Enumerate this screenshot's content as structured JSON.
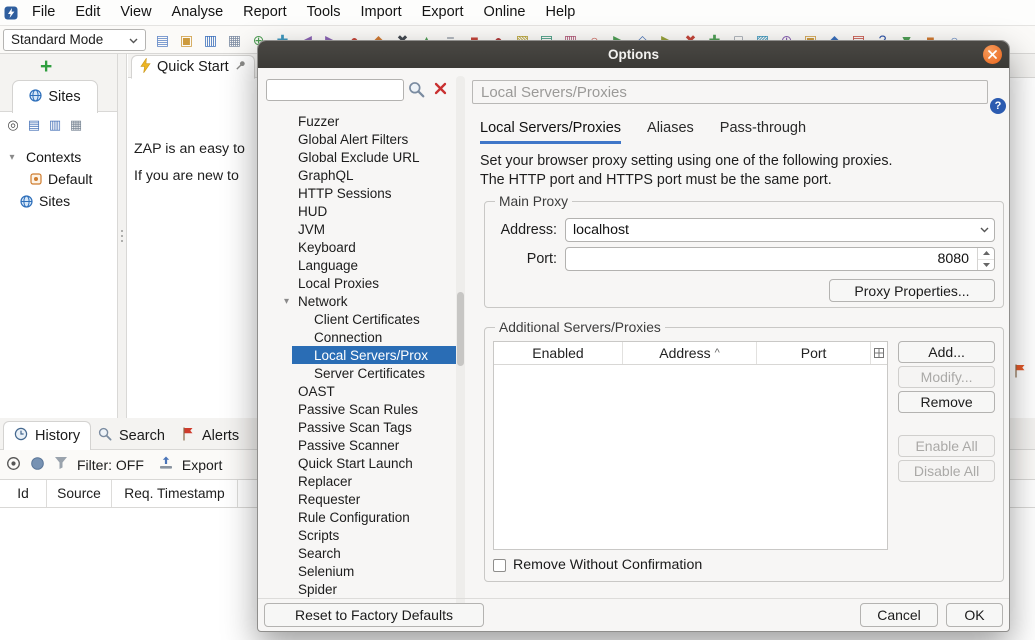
{
  "colors": {
    "selection_blue": "#2a6db5",
    "titlebar_dark": "#3b3a36",
    "close_orange": "#e9651c",
    "tab_accent": "#3f76c8",
    "alert_red": "#cf3b2c"
  },
  "menubar": {
    "items": [
      {
        "label": "File"
      },
      {
        "label": "Edit"
      },
      {
        "label": "View"
      },
      {
        "label": "Analyse"
      },
      {
        "label": "Report"
      },
      {
        "label": "Tools"
      },
      {
        "label": "Import"
      },
      {
        "label": "Export"
      },
      {
        "label": "Online"
      },
      {
        "label": "Help"
      }
    ]
  },
  "toolbar": {
    "mode_label": "Standard Mode",
    "icons": [
      {
        "name": "new-session-icon",
        "glyph": "▤",
        "color": "#5b82c4"
      },
      {
        "name": "open-session-icon",
        "glyph": "▣",
        "color": "#cd9a3d"
      },
      {
        "name": "persist-session-icon",
        "glyph": "▥",
        "color": "#3a6fbb"
      },
      {
        "name": "snapshot-session-icon",
        "glyph": "▦",
        "color": "#7d8ca3"
      },
      {
        "name": "session-properties-icon",
        "glyph": "⊕",
        "color": "#4f9e55"
      },
      {
        "name": "options-icon",
        "glyph": "✚",
        "color": "#3e97bd"
      },
      {
        "name": "undo-icon",
        "glyph": "◀",
        "color": "#8a63b3"
      },
      {
        "name": "redo-icon",
        "glyph": "▶",
        "color": "#8a63b3"
      },
      {
        "name": "search-icon",
        "glyph": "●",
        "color": "#c4453a"
      },
      {
        "name": "alerts-icon",
        "glyph": "◆",
        "color": "#d07a32"
      },
      {
        "name": "spider-icon",
        "glyph": "✖",
        "color": "#444a52"
      },
      {
        "name": "active-scan-icon",
        "glyph": "▲",
        "color": "#4f9e55"
      },
      {
        "name": "pause-icon",
        "glyph": "≡",
        "color": "#6b7686"
      },
      {
        "name": "stop-icon",
        "glyph": "■",
        "color": "#c4453a"
      },
      {
        "name": "record-icon",
        "glyph": "●",
        "color": "#b03a3a"
      },
      {
        "name": "quick-start-icon",
        "glyph": "▧",
        "color": "#b8a233"
      },
      {
        "name": "request-editor-icon",
        "glyph": "▤",
        "color": "#2f8f73"
      },
      {
        "name": "response-editor-icon",
        "glyph": "▥",
        "color": "#b05576"
      },
      {
        "name": "break-icon",
        "glyph": "○",
        "color": "#c4453a"
      },
      {
        "name": "resume-icon",
        "glyph": "▶",
        "color": "#4f9e55"
      },
      {
        "name": "step-icon",
        "glyph": "◇",
        "color": "#4a74b8"
      },
      {
        "name": "continue-icon",
        "glyph": "▶",
        "color": "#97a23a"
      },
      {
        "name": "drop-icon",
        "glyph": "✖",
        "color": "#c4453a"
      },
      {
        "name": "add-breakpoint-icon",
        "glyph": "✚",
        "color": "#4f9e55"
      },
      {
        "name": "scripts-icon",
        "glyph": "□",
        "color": "#6b7686"
      },
      {
        "name": "hud-icon",
        "glyph": "▨",
        "color": "#3e97bd"
      },
      {
        "name": "api-icon",
        "glyph": "⊕",
        "color": "#8a63b3"
      },
      {
        "name": "proxy-icon",
        "glyph": "▣",
        "color": "#cd9a3d"
      },
      {
        "name": "plug-n-hack-icon",
        "glyph": "◆",
        "color": "#3a6fbb"
      },
      {
        "name": "report-icon",
        "glyph": "▤",
        "color": "#c4453a"
      },
      {
        "name": "help-icon",
        "glyph": "?",
        "color": "#2d53a8"
      },
      {
        "name": "update-icon",
        "glyph": "▼",
        "color": "#4f9e55"
      },
      {
        "name": "addons-icon",
        "glyph": "■",
        "color": "#d07a32"
      },
      {
        "name": "user-guide-icon",
        "glyph": "○",
        "color": "#4a74b8"
      }
    ]
  },
  "sidebar": {
    "add_button": "+",
    "sites_tab": "Sites",
    "toolbar_icons": [
      {
        "name": "in-scope-target-icon",
        "glyph": "◎",
        "color": "#4c4c4c"
      },
      {
        "name": "new-context-icon",
        "glyph": "▤",
        "color": "#4a74b8"
      },
      {
        "name": "import-context-icon",
        "glyph": "▥",
        "color": "#4a74b8"
      },
      {
        "name": "export-context-icon",
        "glyph": "▦",
        "color": "#7a8795"
      }
    ],
    "contexts_label": "Contexts",
    "default_label": "Default",
    "sites_label": "Sites"
  },
  "quickstart": {
    "tab_label": "Quick Start",
    "line1": "ZAP is an easy to",
    "line2": "If you are new to"
  },
  "bottom": {
    "tabs": [
      "History",
      "Search",
      "Alerts"
    ],
    "filter_label": "Filter: OFF",
    "export_label": "Export",
    "columns": [
      "Id",
      "Source",
      "Req. Timestamp"
    ]
  },
  "dialog": {
    "title": "Options",
    "search_value": "",
    "chevron_glyph": "▾",
    "help_glyph": "?",
    "tree_items": [
      {
        "label": "Fuzzer",
        "cls": ""
      },
      {
        "label": "Global Alert Filters",
        "cls": ""
      },
      {
        "label": "Global Exclude URL",
        "cls": ""
      },
      {
        "label": "GraphQL",
        "cls": ""
      },
      {
        "label": "HTTP Sessions",
        "cls": ""
      },
      {
        "label": "HUD",
        "cls": ""
      },
      {
        "label": "JVM",
        "cls": ""
      },
      {
        "label": "Keyboard",
        "cls": ""
      },
      {
        "label": "Language",
        "cls": ""
      },
      {
        "label": "Local Proxies",
        "cls": ""
      },
      {
        "label": "Network",
        "cls": "expandable"
      },
      {
        "label": "Client Certificates",
        "cls": "child"
      },
      {
        "label": "Connection",
        "cls": "child"
      },
      {
        "label": "Local Servers/Prox",
        "cls": "child selected"
      },
      {
        "label": "Server Certificates",
        "cls": "child"
      },
      {
        "label": "OAST",
        "cls": ""
      },
      {
        "label": "Passive Scan Rules",
        "cls": ""
      },
      {
        "label": "Passive Scan Tags",
        "cls": ""
      },
      {
        "label": "Passive Scanner",
        "cls": ""
      },
      {
        "label": "Quick Start Launch",
        "cls": ""
      },
      {
        "label": "Replacer",
        "cls": ""
      },
      {
        "label": "Requester",
        "cls": ""
      },
      {
        "label": "Rule Configuration",
        "cls": ""
      },
      {
        "label": "Scripts",
        "cls": ""
      },
      {
        "label": "Search",
        "cls": ""
      },
      {
        "label": "Selenium",
        "cls": ""
      },
      {
        "label": "Spider",
        "cls": ""
      }
    ],
    "panel": {
      "header": "Local Servers/Proxies",
      "tabs": [
        "Local Servers/Proxies",
        "Aliases",
        "Pass-through"
      ],
      "description_line1": "Set your browser proxy setting using one of the following proxies.",
      "description_line2": "The HTTP port and HTTPS port must be the same port.",
      "main_proxy": {
        "group_title": "Main Proxy",
        "address_label": "Address:",
        "address_value": "localhost",
        "port_label": "Port:",
        "port_value": "8080",
        "properties_button": "Proxy Properties..."
      },
      "additional": {
        "group_title": "Additional Servers/Proxies",
        "columns": [
          "Enabled",
          "Address",
          "Port"
        ],
        "sort_glyph": "^",
        "rows": [],
        "buttons": {
          "add": "Add...",
          "modify": "Modify...",
          "remove": "Remove",
          "enable_all": "Enable All",
          "disable_all": "Disable All"
        },
        "checkbox_label": "Remove Without Confirmation"
      }
    },
    "footer": {
      "reset": "Reset to Factory Defaults",
      "cancel": "Cancel",
      "ok": "OK"
    }
  }
}
